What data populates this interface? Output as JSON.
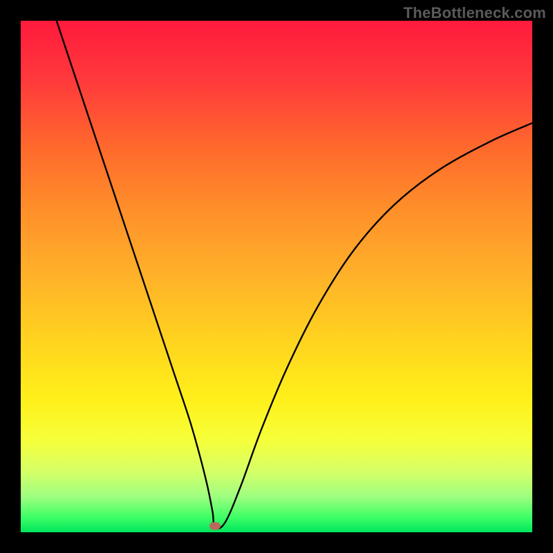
{
  "watermark": "TheBottleneck.com",
  "chart_data": {
    "type": "line",
    "title": "",
    "xlabel": "",
    "ylabel": "",
    "xlim": [
      0,
      100
    ],
    "ylim": [
      0,
      100
    ],
    "grid": false,
    "legend": false,
    "series": [
      {
        "name": "curve",
        "x": [
          7,
          10,
          14,
          18,
          22,
          26,
          30,
          33,
          35,
          36.5,
          37.5,
          38,
          40,
          43,
          47,
          52,
          58,
          65,
          73,
          82,
          92,
          100
        ],
        "y": [
          100,
          91,
          79,
          67,
          55,
          43,
          31,
          22,
          15,
          9,
          4,
          0.8,
          2,
          9,
          20,
          32,
          44,
          55,
          64,
          71,
          76.5,
          80
        ]
      }
    ],
    "marker": {
      "x": 38,
      "y": 1.2
    },
    "background": {
      "type": "vertical-gradient",
      "stops": [
        {
          "pos": 0,
          "color": "#ff1a3c"
        },
        {
          "pos": 25,
          "color": "#ff6a2c"
        },
        {
          "pos": 50,
          "color": "#ffb229"
        },
        {
          "pos": 74,
          "color": "#fff01a"
        },
        {
          "pos": 100,
          "color": "#00e65c"
        }
      ]
    }
  }
}
